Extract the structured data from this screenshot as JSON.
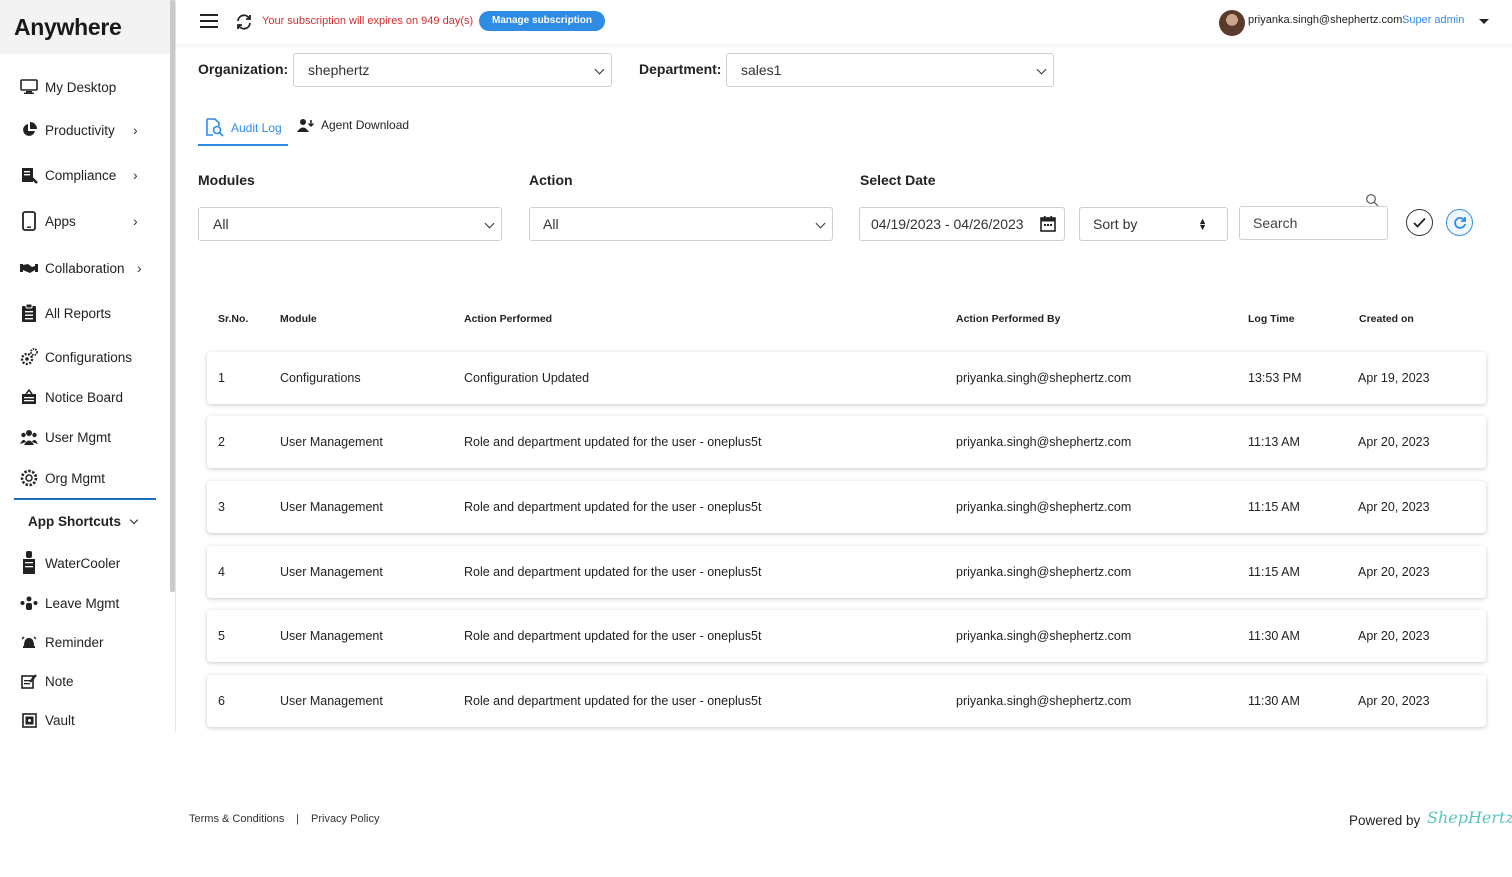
{
  "brand": {
    "logo_text": "Anywhere",
    "accent": "#2f8ce5",
    "divider_color": "#1f6fb6"
  },
  "topbar": {
    "subscription_text": "Your subscription will expires on 949 day(s)",
    "manage_label": "Manage subscription",
    "user_email": "priyanka.singh@shephertz.com",
    "user_role": "Super admin"
  },
  "sidebar": {
    "items": [
      {
        "label": "My Desktop",
        "icon": "monitor-icon"
      },
      {
        "label": "Productivity",
        "icon": "pie-chart-icon"
      },
      {
        "label": "Compliance",
        "icon": "compliance-icon"
      },
      {
        "label": "Apps",
        "icon": "phone-icon"
      },
      {
        "label": "Collaboration",
        "icon": "handshake-icon"
      },
      {
        "label": "All Reports",
        "icon": "clipboard-icon"
      },
      {
        "label": "Configurations",
        "icon": "gears-icon"
      },
      {
        "label": "Notice Board",
        "icon": "notice-board-icon"
      },
      {
        "label": "User Mgmt",
        "icon": "users-icon"
      },
      {
        "label": "Org Mgmt",
        "icon": "org-gear-icon"
      }
    ],
    "shortcuts_title": "App Shortcuts",
    "shortcuts": [
      {
        "label": "WaterCooler",
        "icon": "water-cooler-icon"
      },
      {
        "label": "Leave Mgmt",
        "icon": "leave-icon"
      },
      {
        "label": "Reminder",
        "icon": "alarm-icon"
      },
      {
        "label": "Note",
        "icon": "note-icon"
      },
      {
        "label": "Vault",
        "icon": "vault-icon"
      }
    ]
  },
  "filters": {
    "org_label": "Organization:",
    "org_value": "shephertz",
    "dept_label": "Department:",
    "dept_value": "sales1",
    "modules_label": "Modules",
    "modules_value": "All",
    "action_label": "Action",
    "action_value": "All",
    "date_label": "Select Date",
    "date_value": "04/19/2023 - 04/26/2023",
    "sort_label": "Sort by",
    "search_placeholder": "Search"
  },
  "tabs": [
    {
      "label": "Audit Log",
      "active": true
    },
    {
      "label": "Agent Download",
      "active": false
    }
  ],
  "table": {
    "headers": [
      "Sr.No.",
      "Module",
      "Action Performed",
      "Action Performed By",
      "Log Time",
      "Created on"
    ],
    "rows": [
      [
        "1",
        "Configurations",
        "Configuration Updated",
        "priyanka.singh@shephertz.com",
        "13:53 PM",
        "Apr 19, 2023"
      ],
      [
        "2",
        "User Management",
        "Role and department updated for the user - oneplus5t",
        "priyanka.singh@shephertz.com",
        "11:13 AM",
        "Apr 20, 2023"
      ],
      [
        "3",
        "User Management",
        "Role and department updated for the user - oneplus5t",
        "priyanka.singh@shephertz.com",
        "11:15 AM",
        "Apr 20, 2023"
      ],
      [
        "4",
        "User Management",
        "Role and department updated for the user - oneplus5t",
        "priyanka.singh@shephertz.com",
        "11:15 AM",
        "Apr 20, 2023"
      ],
      [
        "5",
        "User Management",
        "Role and department updated for the user - oneplus5t",
        "priyanka.singh@shephertz.com",
        "11:30 AM",
        "Apr 20, 2023"
      ],
      [
        "6",
        "User Management",
        "Role and department updated for the user - oneplus5t",
        "priyanka.singh@shephertz.com",
        "11:30 AM",
        "Apr 20, 2023"
      ]
    ]
  },
  "footer": {
    "terms": "Terms & Conditions",
    "separator": "|",
    "privacy": "Privacy Policy",
    "powered_by": "Powered by",
    "powered_brand": "ShepHertz"
  }
}
